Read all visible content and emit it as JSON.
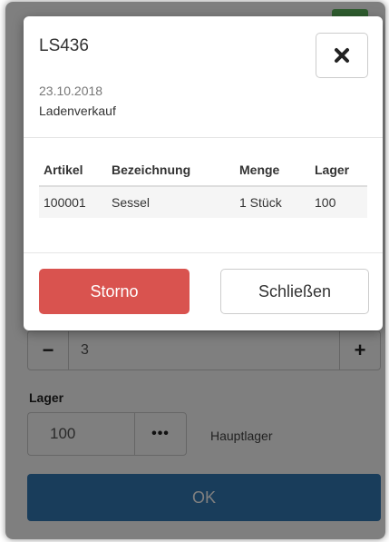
{
  "modal": {
    "title": "LS436",
    "date": "23.10.2018",
    "subtitle": "Ladenverkauf",
    "close_icon": "close-x-icon",
    "table": {
      "headers": [
        "Artikel",
        "Bezeichnung",
        "Menge",
        "Lager"
      ],
      "rows": [
        [
          "100001",
          "Sessel",
          "1 Stück",
          "100"
        ]
      ]
    },
    "storno_label": "Storno",
    "close_label": "Schließen"
  },
  "form": {
    "quantity": {
      "minus_label": "−",
      "value": "3",
      "plus_label": "+"
    },
    "lager": {
      "label": "Lager",
      "value": "100",
      "browse_label": "•••",
      "name": "Hauptlager"
    },
    "ok_label": "OK"
  },
  "colors": {
    "primary": "#337ab7",
    "danger": "#d9534f",
    "success": "#5cb85c"
  }
}
